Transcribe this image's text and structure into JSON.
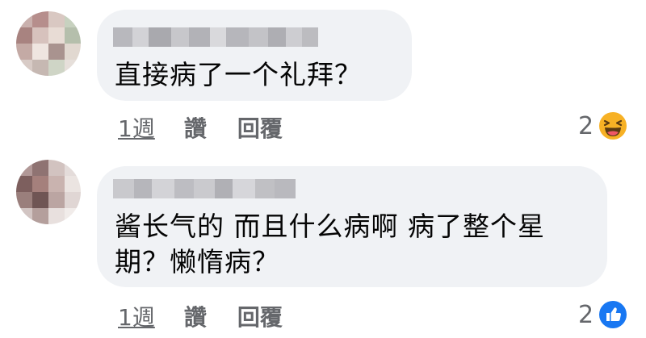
{
  "comments": [
    {
      "text": "直接病了一个礼拜？",
      "time": "1週",
      "like_label": "讚",
      "reply_label": "回覆",
      "reaction_count": "2",
      "reaction_icon": "haha-emoji-icon"
    },
    {
      "text_line1": "酱长气的 而且什么病啊 病了整个星",
      "text_line2": "期？懒惰病？",
      "time": "1週",
      "like_label": "讚",
      "reply_label": "回覆",
      "reaction_count": "2",
      "reaction_icon": "like-thumb-icon"
    }
  ],
  "colors": {
    "bubble": "#f0f2f5",
    "meta_text": "#65676b",
    "like_blue": "#1877f2",
    "haha_yellow": "#f7b125"
  }
}
